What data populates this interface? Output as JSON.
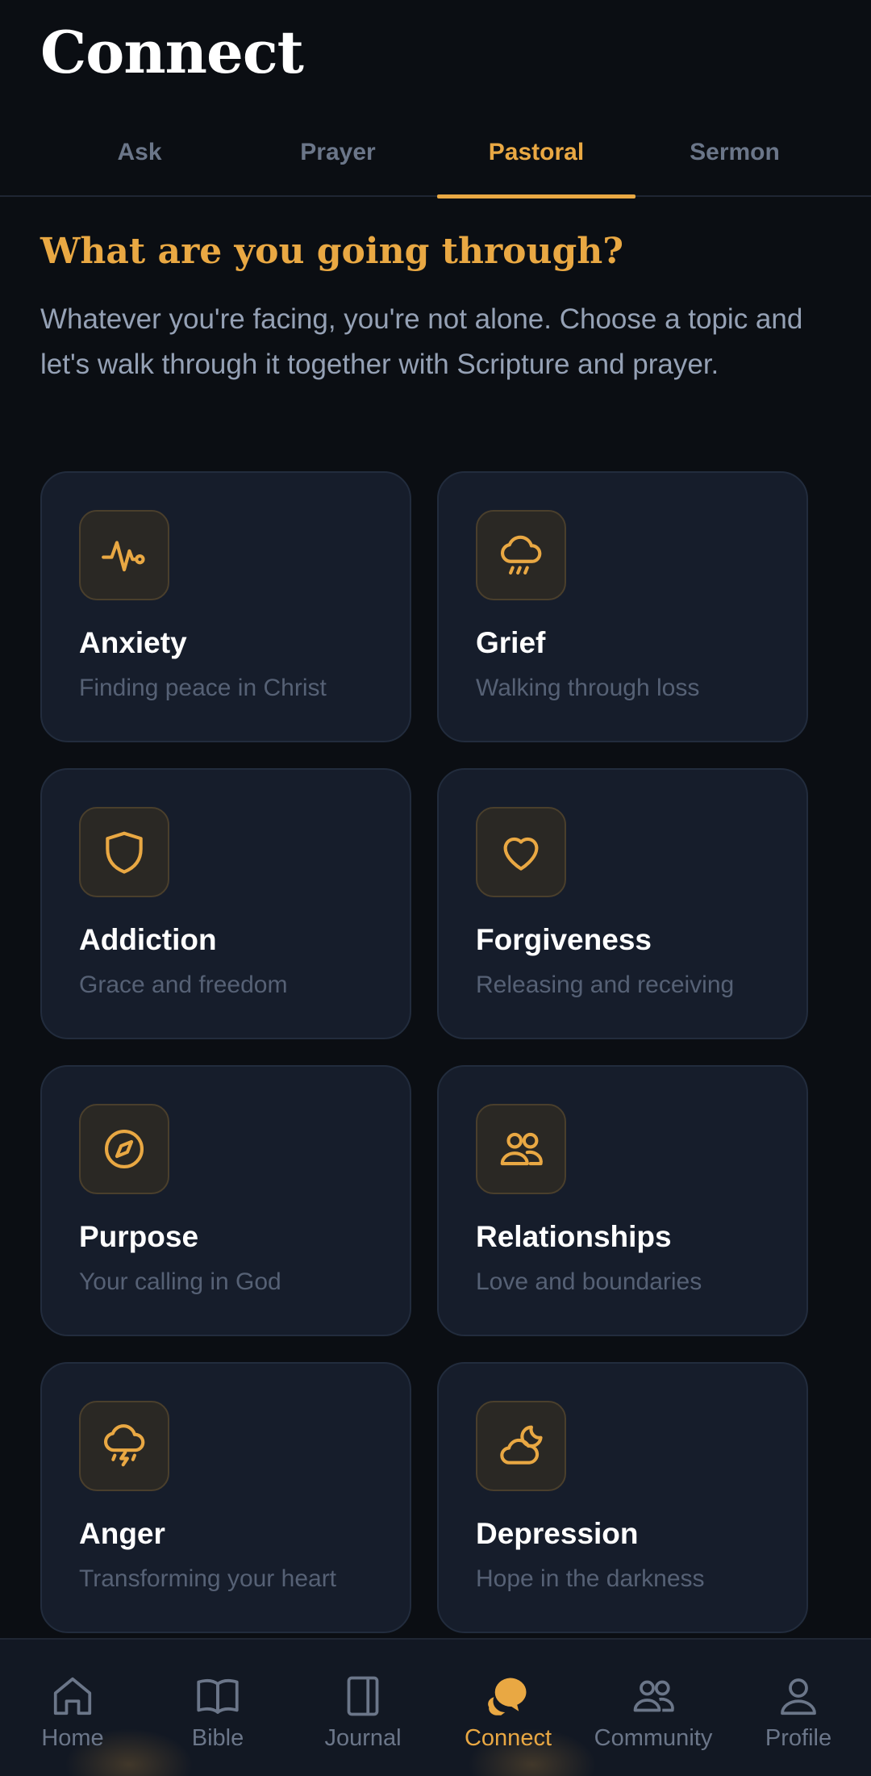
{
  "header": {
    "title": "Connect"
  },
  "tabs": [
    {
      "label": "Ask"
    },
    {
      "label": "Prayer"
    },
    {
      "label": "Pastoral",
      "active": true
    },
    {
      "label": "Sermon"
    }
  ],
  "pastoral": {
    "heading": "What are you going through?",
    "intro": "Whatever you're facing, you're not alone. Choose a topic and let's walk through it together with Scripture and prayer.",
    "topics": [
      {
        "title": "Anxiety",
        "subtitle": "Finding peace in Christ",
        "icon": "pulse-icon"
      },
      {
        "title": "Grief",
        "subtitle": "Walking through loss",
        "icon": "rain-cloud-icon"
      },
      {
        "title": "Addiction",
        "subtitle": "Grace and freedom",
        "icon": "shield-icon"
      },
      {
        "title": "Forgiveness",
        "subtitle": "Releasing and receiving",
        "icon": "heart-icon"
      },
      {
        "title": "Purpose",
        "subtitle": "Your calling in God",
        "icon": "compass-icon"
      },
      {
        "title": "Relationships",
        "subtitle": "Love and boundaries",
        "icon": "people-icon"
      },
      {
        "title": "Anger",
        "subtitle": "Transforming your heart",
        "icon": "storm-cloud-icon"
      },
      {
        "title": "Depression",
        "subtitle": "Hope in the darkness",
        "icon": "cloud-moon-icon"
      }
    ]
  },
  "bottom_nav": [
    {
      "label": "Home",
      "icon": "home-icon"
    },
    {
      "label": "Bible",
      "icon": "book-icon"
    },
    {
      "label": "Journal",
      "icon": "notebook-icon"
    },
    {
      "label": "Connect",
      "icon": "chat-bubbles-icon",
      "active": true
    },
    {
      "label": "Community",
      "icon": "people-icon"
    },
    {
      "label": "Profile",
      "icon": "user-icon"
    }
  ],
  "colors": {
    "accent": "#e9a843",
    "background": "#0b0e13",
    "card": "#161d2b",
    "muted_text": "#6b7689"
  }
}
